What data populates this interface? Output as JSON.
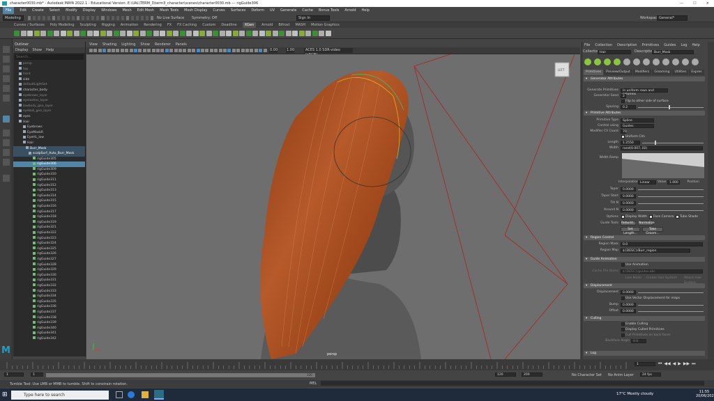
{
  "window": {
    "title": "character0030.mb* - Autodesk MAYA 2022.1 - Educational Version: E:\\UAL\\TERM_3\\term3_character\\scenes\\character0030.mb  ---  rigGuide306"
  },
  "menubar": [
    "File",
    "Edit",
    "Create",
    "Select",
    "Modify",
    "Display",
    "Windows",
    "Mesh",
    "Edit Mesh",
    "Mesh Tools",
    "Mesh Display",
    "Curves",
    "Surfaces",
    "Deform",
    "UV",
    "Generate",
    "Cache",
    "Bonus Tools",
    "Arnold",
    "Help"
  ],
  "statusline": {
    "mode": "Modeling",
    "no_live": "No Live Surface",
    "symmetry": "Symmetry: Off",
    "signin": "Sign In",
    "workspace_label": "Workspace :",
    "workspace": "General*"
  },
  "shelf_tabs": [
    "Curves / Surfaces",
    "Poly Modeling",
    "Sculpting",
    "Rigging",
    "Animation",
    "Rendering",
    "FX",
    "FX Caching",
    "Custom",
    "Deadline",
    "XGen",
    "Arnold",
    "Bifrost",
    "MASH",
    "Motion Graphics"
  ],
  "shelf_active": "XGen",
  "outliner": {
    "title": "Outliner",
    "menu": [
      "Display",
      "Show",
      "Help"
    ],
    "search_placeholder": "Search...",
    "rows": [
      {
        "label": "persp",
        "cls": "dim",
        "indent": 8
      },
      {
        "label": "top",
        "cls": "dim",
        "indent": 8
      },
      {
        "label": "front",
        "cls": "dim",
        "indent": 8
      },
      {
        "label": "side",
        "cls": "",
        "indent": 8
      },
      {
        "label": "defaultLightSet",
        "cls": "dim",
        "indent": 8
      },
      {
        "label": "character_body",
        "cls": "",
        "indent": 8
      },
      {
        "label": "eyebrows_layer",
        "cls": "dim",
        "indent": 8
      },
      {
        "label": "eyelashes_layer",
        "cls": "dim",
        "indent": 8
      },
      {
        "label": "lowbody_geo_layer",
        "cls": "dim",
        "indent": 8
      },
      {
        "label": "eyeball_geo_layer",
        "cls": "dim",
        "indent": 8
      },
      {
        "label": "eyes",
        "cls": "",
        "indent": 8
      },
      {
        "label": "Hair",
        "cls": "",
        "indent": 8
      },
      {
        "label": "Eyebrows",
        "cls": "",
        "indent": 14
      },
      {
        "label": "EyeMaskR",
        "cls": "",
        "indent": 14
      },
      {
        "label": "EyeHL_low",
        "cls": "",
        "indent": 14
      },
      {
        "label": "Hair",
        "cls": "",
        "indent": 14
      },
      {
        "label": "Burr_Mask",
        "cls": "sel2",
        "indent": 18
      },
      {
        "label": "scalpSurf_Auto_Burr_Mask",
        "cls": "sel2",
        "indent": 22
      },
      {
        "label": "rigGuide305",
        "cls": "",
        "indent": 28
      },
      {
        "label": "rigGuide306",
        "cls": "sel",
        "indent": 28
      },
      {
        "label": "rigGuide309",
        "cls": "",
        "indent": 28
      },
      {
        "label": "rigGuide310",
        "cls": "",
        "indent": 28
      },
      {
        "label": "rigGuide311",
        "cls": "",
        "indent": 28
      },
      {
        "label": "rigGuide312",
        "cls": "",
        "indent": 28
      },
      {
        "label": "rigGuide313",
        "cls": "",
        "indent": 28
      },
      {
        "label": "rigGuide314",
        "cls": "",
        "indent": 28
      },
      {
        "label": "rigGuide315",
        "cls": "",
        "indent": 28
      },
      {
        "label": "rigGuide316",
        "cls": "",
        "indent": 28
      },
      {
        "label": "rigGuide317",
        "cls": "",
        "indent": 28
      },
      {
        "label": "rigGuide318",
        "cls": "",
        "indent": 28
      },
      {
        "label": "rigGuide319",
        "cls": "",
        "indent": 28
      },
      {
        "label": "rigGuide321",
        "cls": "",
        "indent": 28
      },
      {
        "label": "rigGuide322",
        "cls": "",
        "indent": 28
      },
      {
        "label": "rigGuide323",
        "cls": "",
        "indent": 28
      },
      {
        "label": "rigGuide324",
        "cls": "",
        "indent": 28
      },
      {
        "label": "rigGuide325",
        "cls": "",
        "indent": 28
      },
      {
        "label": "rigGuide326",
        "cls": "",
        "indent": 28
      },
      {
        "label": "rigGuide327",
        "cls": "",
        "indent": 28
      },
      {
        "label": "rigGuide328",
        "cls": "",
        "indent": 28
      },
      {
        "label": "rigGuide329",
        "cls": "",
        "indent": 28
      },
      {
        "label": "rigGuide330",
        "cls": "",
        "indent": 28
      },
      {
        "label": "rigGuide331",
        "cls": "",
        "indent": 28
      },
      {
        "label": "rigGuide332",
        "cls": "",
        "indent": 28
      },
      {
        "label": "rigGuide333",
        "cls": "",
        "indent": 28
      },
      {
        "label": "rigGuide334",
        "cls": "",
        "indent": 28
      },
      {
        "label": "rigGuide335",
        "cls": "",
        "indent": 28
      },
      {
        "label": "rigGuide336",
        "cls": "",
        "indent": 28
      },
      {
        "label": "rigGuide337",
        "cls": "",
        "indent": 28
      },
      {
        "label": "rigGuide338",
        "cls": "",
        "indent": 28
      },
      {
        "label": "rigGuide339",
        "cls": "",
        "indent": 28
      },
      {
        "label": "rigGuide340",
        "cls": "",
        "indent": 28
      },
      {
        "label": "rigGuide341",
        "cls": "",
        "indent": 28
      },
      {
        "label": "rigGuide342",
        "cls": "",
        "indent": 28
      }
    ]
  },
  "viewport": {
    "menu": [
      "View",
      "Shading",
      "Lighting",
      "Show",
      "Renderer",
      "Panels"
    ],
    "camera": "persp",
    "cube_label": "LEFT",
    "val1": "0.00",
    "val2": "1.00",
    "colorspace": "ACES 1.0 SDR-video (sRGB)"
  },
  "attr": {
    "menu": [
      "File",
      "Collection",
      "Description",
      "Primitives",
      "Guides",
      "Log",
      "Help"
    ],
    "collection_label": "Collection",
    "collection": "Hair",
    "description_label": "Description",
    "description": "Burr_Mask",
    "tabs": [
      "Primitives",
      "Preview/Output",
      "Modifiers",
      "Grooming",
      "Utilities",
      "Expres"
    ],
    "gen_section": "Generator Attributes",
    "gen_prim_label": "Generate Primitives",
    "gen_prim": "In uniform rows and columns",
    "gen_seed_label": "Generator Seed",
    "gen_seed": "2",
    "flip_label": "Flip to other side of surface",
    "spacing_label": "Spacing",
    "spacing": "0.2",
    "prim_section": "Primitive Attributes",
    "ptype_label": "Primitive Type",
    "ptype": "Spline",
    "ctrl_label": "Control using",
    "ctrl": "Guides",
    "cv_label": "Modifier CV Count",
    "cv": "70",
    "uniform_label": "Uniform CVs",
    "length_label": "Length",
    "length": "1.2550",
    "width_label": "Width",
    "width": "rand(0.007,.02)",
    "ramp_label": "Width Ramp",
    "interp_label": "Interpolation",
    "interp": "Linear",
    "value_label": "Value",
    "value": "1.000",
    "pos_label": "Position",
    "taper_label": "Taper",
    "taper": "0.0000",
    "taper_start_label": "Taper Start",
    "taper_start": "0.0000",
    "tilt_label": "Tilt N",
    "tilt": "0.0000",
    "around_label": "Around N",
    "around": "0.0000",
    "options_label": "Options",
    "disp_width": "Display Width",
    "face_camera": "Face Camera",
    "tube_shade": "Tube Shade",
    "guide_tools_label": "Guide Tools",
    "rebuild": "Rebuild...",
    "normalize": "Normalize",
    "set_length": "Set Length...",
    "take_groom": "Take Groom...",
    "region_section": "Region Control",
    "region_mask_label": "Region Mask",
    "region_mask": "0.0",
    "region_map_label": "Region Map",
    "region_map": "${DESC}/Burr_region",
    "guide_anim_section": "Guide Animation",
    "use_anim": "Use Animation",
    "cache_label": "Cache File Name",
    "cache": "${DESC}/guides.abc",
    "live_mode": "Live Mode",
    "create_sys": "Create Hair System",
    "attach_label": "Attach Hair System",
    "disp_section": "Displacement",
    "displacement_label": "Displacement",
    "displacement": "0.0000",
    "vector_disp": "Use Vector Displacement for maps",
    "bump_label": "Bump",
    "bump": "0.0000",
    "offset_label": "Offset",
    "offset": "0.0000",
    "culling_section": "Culling",
    "enable_culling": "Enable Culling",
    "display_culled": "Display Culled Primitives",
    "cull_back": "Cull Primitives on back faces",
    "culling_angle_label": "Backface Angle",
    "culling_angle": "0.0",
    "log_section": "Log"
  },
  "time": {
    "start": "1",
    "start2": "1",
    "current": "120",
    "end": "120",
    "end2": "200",
    "frame": "1",
    "no_char": "No Character Set",
    "no_anim": "No Anim Layer",
    "fps": "24 fps"
  },
  "cmd": {
    "lang": "MEL",
    "help": "Tumble Tool: Use LMB or MMB to tumble. Shift to constrain rotation."
  },
  "taskbar": {
    "search": "Type here to search",
    "weather": "17°C  Mostly cloudy",
    "time": "11:55",
    "date": "20/06/2022"
  }
}
